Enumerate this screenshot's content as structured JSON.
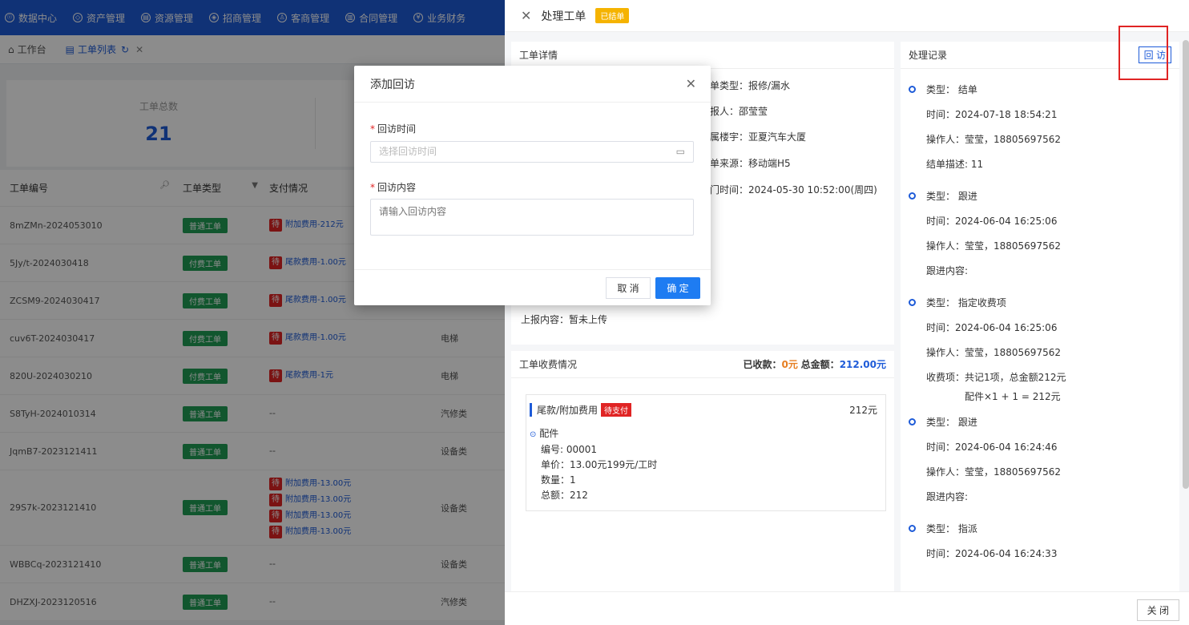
{
  "nav": {
    "items": [
      {
        "label": "数据中心",
        "icon": "☉"
      },
      {
        "label": "资产管理",
        "icon": "◇"
      },
      {
        "label": "资源管理",
        "icon": "▤"
      },
      {
        "label": "招商管理",
        "icon": "◈"
      },
      {
        "label": "客商管理",
        "icon": "♙"
      },
      {
        "label": "合同管理",
        "icon": "▥"
      },
      {
        "label": "业务财务",
        "icon": "¥"
      }
    ]
  },
  "tabs": {
    "workbench": "工作台",
    "list": "工单列表"
  },
  "stats": {
    "total_label": "工单总数",
    "total_value": "21"
  },
  "table": {
    "headers": {
      "id": "工单编号",
      "type": "工单类型",
      "pay": "支付情况"
    },
    "rows": [
      {
        "id": "8mZMn-2024053010",
        "type": "普通工单",
        "pay": [
          {
            "flag": "待",
            "text": "附加费用-212元"
          }
        ],
        "cat": ""
      },
      {
        "id": "5Jy/t-2024030418",
        "type": "付费工单",
        "pay": [
          {
            "flag": "待",
            "text": "尾款费用-1.00元"
          }
        ],
        "cat": ""
      },
      {
        "id": "ZCSM9-2024030417",
        "type": "付费工单",
        "pay": [
          {
            "flag": "待",
            "text": "尾款费用-1.00元"
          }
        ],
        "cat": ""
      },
      {
        "id": "cuv6T-2024030417",
        "type": "付费工单",
        "pay": [
          {
            "flag": "待",
            "text": "尾款费用-1.00元"
          }
        ],
        "cat": "电梯"
      },
      {
        "id": "820U-2024030210",
        "type": "付费工单",
        "pay": [
          {
            "flag": "待",
            "text": "尾款费用-1元"
          }
        ],
        "cat": "电梯"
      },
      {
        "id": "S8TyH-2024010314",
        "type": "普通工单",
        "pay": [
          {
            "flag": "",
            "text": "--"
          }
        ],
        "cat": "汽修类"
      },
      {
        "id": "JqmB7-2023121411",
        "type": "普通工单",
        "pay": [
          {
            "flag": "",
            "text": "--"
          }
        ],
        "cat": "设备类"
      },
      {
        "id": "29S7k-2023121410",
        "type": "普通工单",
        "pay": [
          {
            "flag": "待",
            "text": "附加费用-13.00元"
          },
          {
            "flag": "待",
            "text": "附加费用-13.00元"
          },
          {
            "flag": "待",
            "text": "附加费用-13.00元"
          },
          {
            "flag": "待",
            "text": "附加费用-13.00元"
          }
        ],
        "cat": "设备类"
      },
      {
        "id": "WBBCq-2023121410",
        "type": "普通工单",
        "pay": [
          {
            "flag": "",
            "text": "--"
          }
        ],
        "cat": "设备类"
      },
      {
        "id": "DHZXJ-2023120516",
        "type": "普通工单",
        "pay": [
          {
            "flag": "",
            "text": "--"
          }
        ],
        "cat": "汽修类"
      }
    ]
  },
  "drawer": {
    "title": "处理工单",
    "status": "已结单",
    "detail_title": "工单详情",
    "detail": {
      "type": "单类型：报修/漏水",
      "reporter": "报人：邵莹莹",
      "building": "属楼宇：亚夏汽车大厦",
      "source": "单来源：移动端H5",
      "visit_time": "门时间：2024-05-30 10:52:00(周四)",
      "content": "上报内容：暂未上传"
    },
    "fee_title": "工单收费情况",
    "fee_paid_label": "已收款：",
    "fee_paid_value": "0元",
    "fee_total_label": "总金额：",
    "fee_total_value": "212.00元",
    "fee_item_title": "尾款/附加费用",
    "fee_item_status": "待支付",
    "fee_item_amount": "212元",
    "fee_part_name": "配件",
    "fee_part_code": "编号: 00001",
    "fee_part_price": "单价：13.00元199元/工时",
    "fee_part_qty": "数量：1",
    "fee_part_total": "总额：212",
    "records_title": "处理记录",
    "revisit_button": "回 访",
    "records": [
      {
        "lines": [
          "类型：  结单",
          "时间：2024-07-18 18:54:21",
          "操作人：莹莹，18805697562",
          "结单描述: 11"
        ]
      },
      {
        "lines": [
          "类型：  跟进",
          "时间：2024-06-04 16:25:06",
          "操作人：莹莹，18805697562",
          "跟进内容:"
        ]
      },
      {
        "lines": [
          "类型：  指定收费项",
          "时间：2024-06-04 16:25:06",
          "操作人：莹莹，18805697562",
          "收费项：共记1项，总金额212元"
        ],
        "extra": "配件×1 + 1 = 212元"
      },
      {
        "lines": [
          "类型：  跟进",
          "时间：2024-06-04 16:24:46",
          "操作人：莹莹，18805697562",
          "跟进内容:"
        ]
      },
      {
        "lines": [
          "类型：  指派",
          "时间：2024-06-04 16:24:33"
        ]
      }
    ],
    "close_button": "关 闭"
  },
  "modal": {
    "title": "添加回访",
    "time_label": "回访时间",
    "time_placeholder": "选择回访时间",
    "content_label": "回访内容",
    "content_placeholder": "请输入回访内容",
    "cancel": "取 消",
    "ok": "确 定"
  },
  "colors": {
    "primary": "#1e5bd8",
    "danger": "#e02424",
    "success": "#1f9d55",
    "warning": "#f5b301"
  }
}
